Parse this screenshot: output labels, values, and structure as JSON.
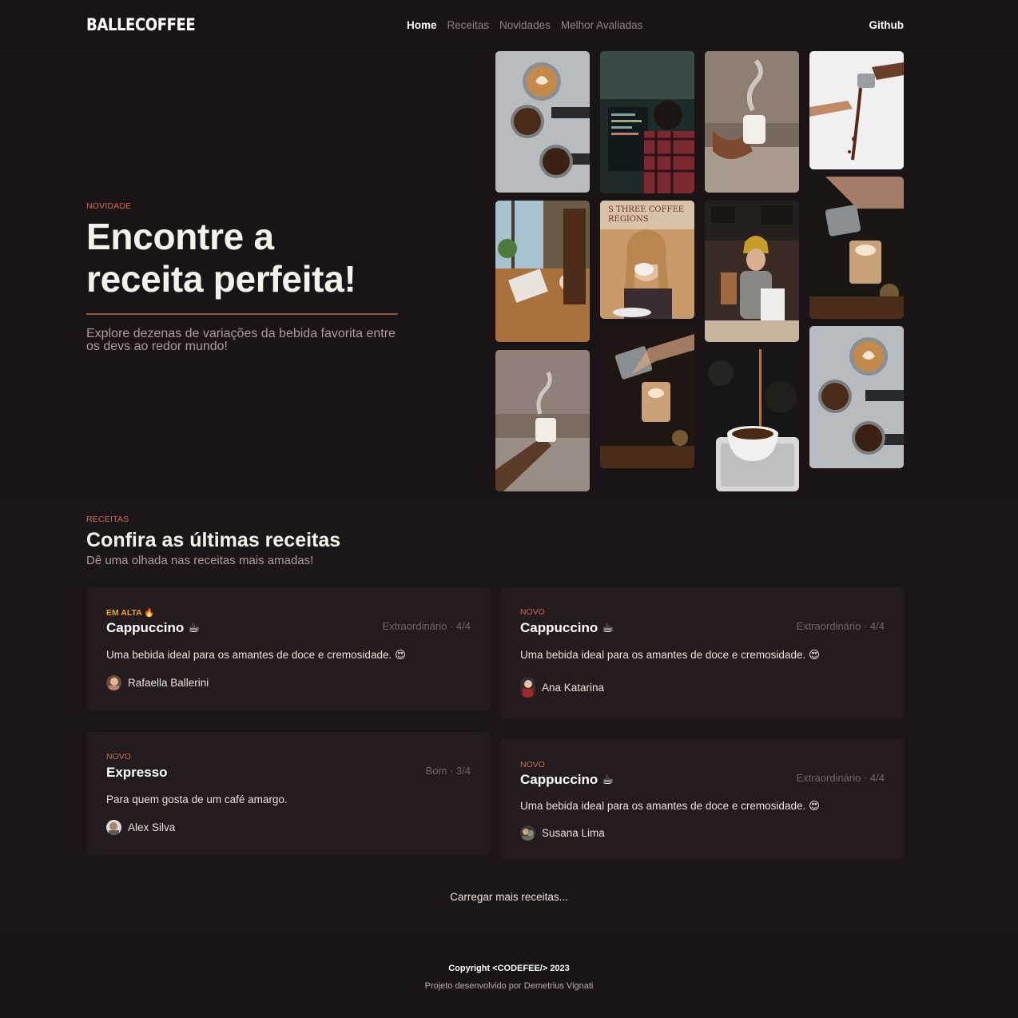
{
  "nav": {
    "logo": "BALLECOFFEE",
    "links": [
      "Home",
      "Receitas",
      "Novidades",
      "Melhor Avaliadas"
    ],
    "github": "Github"
  },
  "hero": {
    "eyebrow": "NOVIDADE",
    "title_line1": "Encontre a",
    "title_line2": "receita perfeita!",
    "subtitle": "Explore dezenas de variações da bebida favorita entre os devs ao redor mundo!"
  },
  "gallery": {
    "photos": [
      "latte-art-and-beans-photo",
      "developer-with-code-photo",
      "hand-holding-mug-photo",
      "pouring-coffee-stream-photo",
      "cafe-window-table-photo",
      "woman-drinking-coffee-photo",
      "barista-in-yellow-hat-photo",
      "barista-pouring-latte-photo",
      "steaming-mug-by-window-photo",
      "latte-pour-closeup-photo",
      "coffee-drip-into-cup-photo",
      "latte-art-and-beans-photo-2"
    ]
  },
  "recipes": {
    "eyebrow": "RECEITAS",
    "title": "Confira as últimas receitas",
    "subtitle": "Dê uma olhada nas receitas mais amadas!",
    "cards": [
      {
        "badge": "EM ALTA 🔥",
        "title": "Cappuccino ☕",
        "rating": "Extraordinário · 4/4",
        "description": "Uma bebida ideal para os amantes de doce e cremosidade. 😍",
        "author": "Rafaella Ballerini"
      },
      {
        "badge": "NOVO",
        "title": "Cappuccino ☕",
        "rating": "Extraordinário · 4/4",
        "description": "Uma bebida ideal para os amantes de doce e cremosidade. 😍",
        "author": "Ana Katarina"
      },
      {
        "badge": "NOVO",
        "title": "Expresso",
        "rating": "Bom · 3/4",
        "description": "Para quem gosta de um café amargo.",
        "author": "Alex Silva"
      },
      {
        "badge": "NOVO",
        "title": "Cappuccino ☕",
        "rating": "Extraordinário · 4/4",
        "description": "Uma bebida ideal para os amantes de doce e cremosidade. 😍",
        "author": "Susana Lima"
      }
    ],
    "load_more": "Carregar mais receitas..."
  },
  "footer": {
    "copyright": "Copyright <CODEFEE/> 2023",
    "credits": "Projeto desenvolvido por Demetrius Vignati"
  },
  "colors": {
    "background": "#1b1416",
    "accent": "#d06a4c",
    "hot": "#f0a13a",
    "card": "#231b1d"
  }
}
